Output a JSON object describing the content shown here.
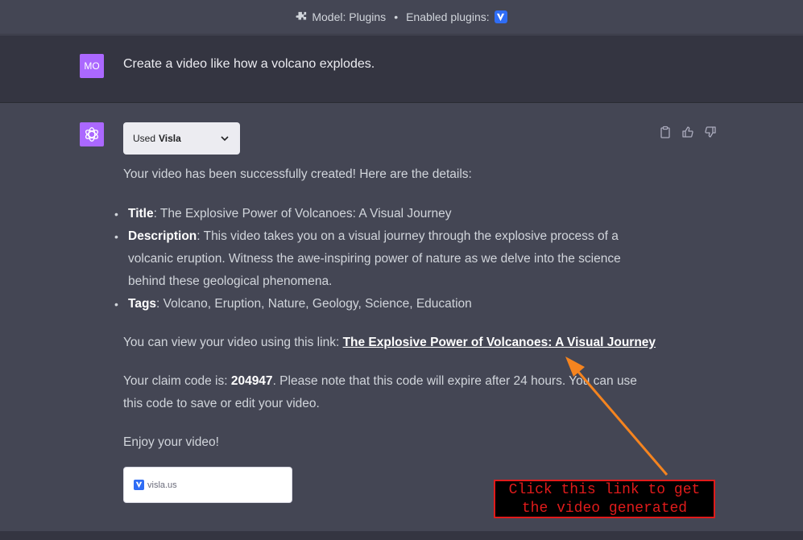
{
  "topbar": {
    "model_text": "Model: Plugins",
    "separator": "•",
    "enabled_label": "Enabled plugins:",
    "plugin_icon": "visla-icon"
  },
  "user_message": {
    "avatar_initials": "MO",
    "text": "Create a video like how a volcano explodes."
  },
  "assistant": {
    "used_plugin_prefix": "Used",
    "used_plugin_name": "Visla",
    "intro": "Your video has been successfully created! Here are the details:",
    "details": [
      {
        "key": "Title",
        "value": ": The Explosive Power of Volcanoes: A Visual Journey"
      },
      {
        "key": "Description",
        "value": ": This video takes you on a visual journey through the explosive process of a volcanic eruption. Witness the awe-inspiring power of nature as we delve into the science behind these geological phenomena."
      },
      {
        "key": "Tags",
        "value": ": Volcano, Eruption, Nature, Geology, Science, Education"
      }
    ],
    "link_prefix": "You can view your video using this link: ",
    "link_text": "The Explosive Power of Volcanoes: A Visual Journey",
    "claim_prefix": "Your claim code is: ",
    "claim_code": "204947",
    "claim_suffix": ". Please note that this code will expire after 24 hours. You can use this code to save or edit your video.",
    "outro": "Enjoy your video!",
    "card_label": "visla.us",
    "actions": [
      "clipboard-icon",
      "thumbs-up-icon",
      "thumbs-down-icon"
    ]
  },
  "annotation": {
    "line1": "Click this link to get",
    "line2": "the video generated",
    "color": "#e01b1b",
    "arrow_color": "#f5841f"
  }
}
